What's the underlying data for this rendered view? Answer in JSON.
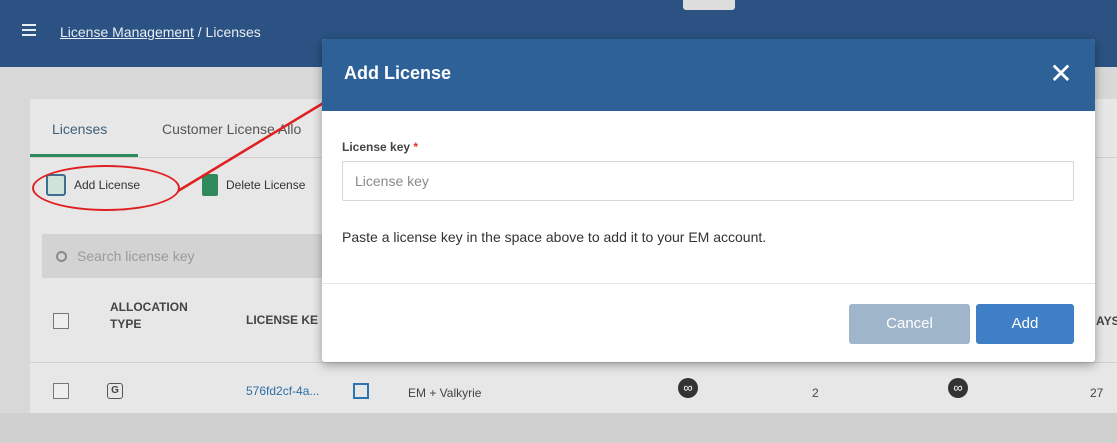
{
  "topbar": {
    "breadcrumb_link": "License Management",
    "breadcrumb_sep": " / ",
    "breadcrumb_current": "Licenses"
  },
  "tabs": {
    "licenses": "Licenses",
    "customer_allocation": "Customer License Allo"
  },
  "toolbar": {
    "add_license": "Add License",
    "delete_license": "Delete License"
  },
  "search": {
    "placeholder": "Search license key"
  },
  "table": {
    "headers": {
      "allocation_type_line1": "ALLOCATION",
      "allocation_type_line2": "TYPE",
      "license_key": "LICENSE KE"
    },
    "row": {
      "type_badge": "G",
      "license_key": "576fd2cf-4a...",
      "product": "EM + Valkyrie",
      "count": "2",
      "days": "27"
    },
    "edge_header": "AYS"
  },
  "modal": {
    "title": "Add License",
    "close": "✕",
    "field_label": "License key",
    "required_mark": " *",
    "input_placeholder": "License key",
    "input_value": "",
    "helper_text": "Paste a license key in the space above to add it to your EM account.",
    "cancel": "Cancel",
    "add": "Add"
  },
  "icons": {
    "menu": "menu-icon",
    "close": "close-icon",
    "search": "search-icon",
    "add_license": "license-certificate-icon",
    "delete": "trash-icon",
    "infinity": "infinity-icon",
    "copy": "copy-icon"
  },
  "colors": {
    "header_blue": "#2f6199",
    "add_button": "#3f7fc6",
    "cancel_button": "#9fb5c9",
    "annotation_red": "#e02020",
    "tab_underline": "#2f8a5e"
  }
}
